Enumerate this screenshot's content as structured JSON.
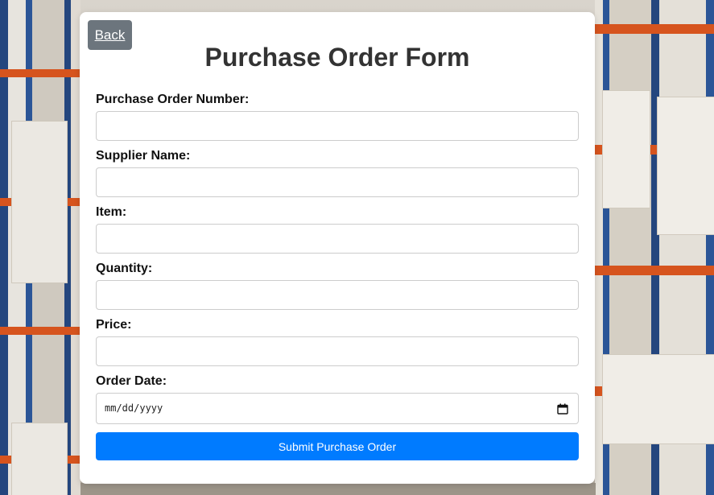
{
  "back_button": {
    "label": "Back"
  },
  "form": {
    "title": "Purchase Order Form",
    "fields": [
      {
        "label": "Purchase Order Number:",
        "value": ""
      },
      {
        "label": "Supplier Name:",
        "value": ""
      },
      {
        "label": "Item:",
        "value": ""
      },
      {
        "label": "Quantity:",
        "value": ""
      },
      {
        "label": "Price:",
        "value": ""
      },
      {
        "label": "Order Date:",
        "placeholder": "mm/dd/yyyy",
        "icon": "calendar-icon"
      }
    ],
    "submit_label": "Submit Purchase Order"
  },
  "colors": {
    "back_button_bg": "#6c757d",
    "submit_button_bg": "#007bff",
    "title_text": "#333333",
    "card_bg": "#ffffff"
  }
}
